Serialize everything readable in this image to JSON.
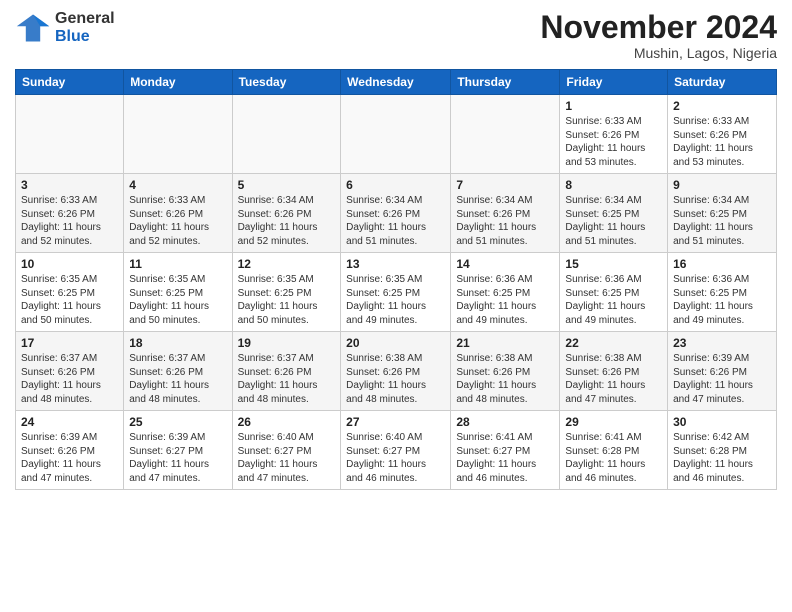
{
  "header": {
    "logo": {
      "line1": "General",
      "line2": "Blue"
    },
    "title": "November 2024",
    "location": "Mushin, Lagos, Nigeria"
  },
  "weekdays": [
    "Sunday",
    "Monday",
    "Tuesday",
    "Wednesday",
    "Thursday",
    "Friday",
    "Saturday"
  ],
  "weeks": [
    [
      {
        "day": "",
        "info": ""
      },
      {
        "day": "",
        "info": ""
      },
      {
        "day": "",
        "info": ""
      },
      {
        "day": "",
        "info": ""
      },
      {
        "day": "",
        "info": ""
      },
      {
        "day": "1",
        "info": "Sunrise: 6:33 AM\nSunset: 6:26 PM\nDaylight: 11 hours\nand 53 minutes."
      },
      {
        "day": "2",
        "info": "Sunrise: 6:33 AM\nSunset: 6:26 PM\nDaylight: 11 hours\nand 53 minutes."
      }
    ],
    [
      {
        "day": "3",
        "info": "Sunrise: 6:33 AM\nSunset: 6:26 PM\nDaylight: 11 hours\nand 52 minutes."
      },
      {
        "day": "4",
        "info": "Sunrise: 6:33 AM\nSunset: 6:26 PM\nDaylight: 11 hours\nand 52 minutes."
      },
      {
        "day": "5",
        "info": "Sunrise: 6:34 AM\nSunset: 6:26 PM\nDaylight: 11 hours\nand 52 minutes."
      },
      {
        "day": "6",
        "info": "Sunrise: 6:34 AM\nSunset: 6:26 PM\nDaylight: 11 hours\nand 51 minutes."
      },
      {
        "day": "7",
        "info": "Sunrise: 6:34 AM\nSunset: 6:26 PM\nDaylight: 11 hours\nand 51 minutes."
      },
      {
        "day": "8",
        "info": "Sunrise: 6:34 AM\nSunset: 6:25 PM\nDaylight: 11 hours\nand 51 minutes."
      },
      {
        "day": "9",
        "info": "Sunrise: 6:34 AM\nSunset: 6:25 PM\nDaylight: 11 hours\nand 51 minutes."
      }
    ],
    [
      {
        "day": "10",
        "info": "Sunrise: 6:35 AM\nSunset: 6:25 PM\nDaylight: 11 hours\nand 50 minutes."
      },
      {
        "day": "11",
        "info": "Sunrise: 6:35 AM\nSunset: 6:25 PM\nDaylight: 11 hours\nand 50 minutes."
      },
      {
        "day": "12",
        "info": "Sunrise: 6:35 AM\nSunset: 6:25 PM\nDaylight: 11 hours\nand 50 minutes."
      },
      {
        "day": "13",
        "info": "Sunrise: 6:35 AM\nSunset: 6:25 PM\nDaylight: 11 hours\nand 49 minutes."
      },
      {
        "day": "14",
        "info": "Sunrise: 6:36 AM\nSunset: 6:25 PM\nDaylight: 11 hours\nand 49 minutes."
      },
      {
        "day": "15",
        "info": "Sunrise: 6:36 AM\nSunset: 6:25 PM\nDaylight: 11 hours\nand 49 minutes."
      },
      {
        "day": "16",
        "info": "Sunrise: 6:36 AM\nSunset: 6:25 PM\nDaylight: 11 hours\nand 49 minutes."
      }
    ],
    [
      {
        "day": "17",
        "info": "Sunrise: 6:37 AM\nSunset: 6:26 PM\nDaylight: 11 hours\nand 48 minutes."
      },
      {
        "day": "18",
        "info": "Sunrise: 6:37 AM\nSunset: 6:26 PM\nDaylight: 11 hours\nand 48 minutes."
      },
      {
        "day": "19",
        "info": "Sunrise: 6:37 AM\nSunset: 6:26 PM\nDaylight: 11 hours\nand 48 minutes."
      },
      {
        "day": "20",
        "info": "Sunrise: 6:38 AM\nSunset: 6:26 PM\nDaylight: 11 hours\nand 48 minutes."
      },
      {
        "day": "21",
        "info": "Sunrise: 6:38 AM\nSunset: 6:26 PM\nDaylight: 11 hours\nand 48 minutes."
      },
      {
        "day": "22",
        "info": "Sunrise: 6:38 AM\nSunset: 6:26 PM\nDaylight: 11 hours\nand 47 minutes."
      },
      {
        "day": "23",
        "info": "Sunrise: 6:39 AM\nSunset: 6:26 PM\nDaylight: 11 hours\nand 47 minutes."
      }
    ],
    [
      {
        "day": "24",
        "info": "Sunrise: 6:39 AM\nSunset: 6:26 PM\nDaylight: 11 hours\nand 47 minutes."
      },
      {
        "day": "25",
        "info": "Sunrise: 6:39 AM\nSunset: 6:27 PM\nDaylight: 11 hours\nand 47 minutes."
      },
      {
        "day": "26",
        "info": "Sunrise: 6:40 AM\nSunset: 6:27 PM\nDaylight: 11 hours\nand 47 minutes."
      },
      {
        "day": "27",
        "info": "Sunrise: 6:40 AM\nSunset: 6:27 PM\nDaylight: 11 hours\nand 46 minutes."
      },
      {
        "day": "28",
        "info": "Sunrise: 6:41 AM\nSunset: 6:27 PM\nDaylight: 11 hours\nand 46 minutes."
      },
      {
        "day": "29",
        "info": "Sunrise: 6:41 AM\nSunset: 6:28 PM\nDaylight: 11 hours\nand 46 minutes."
      },
      {
        "day": "30",
        "info": "Sunrise: 6:42 AM\nSunset: 6:28 PM\nDaylight: 11 hours\nand 46 minutes."
      }
    ]
  ]
}
